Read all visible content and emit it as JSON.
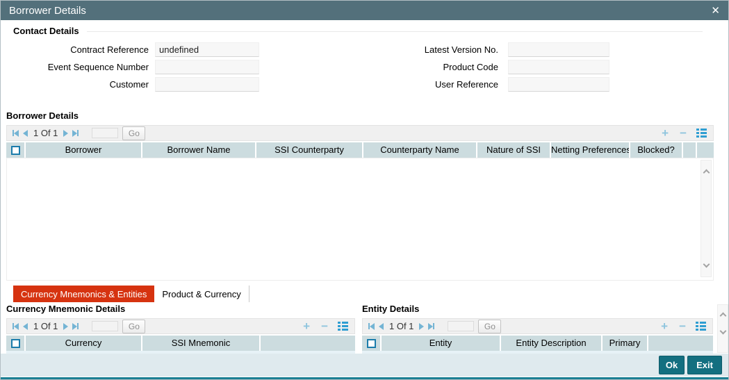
{
  "window": {
    "title": "Borrower Details"
  },
  "icons": {
    "close": "✕",
    "add": "+",
    "remove": "−"
  },
  "colors": {
    "titlebar": "#53707b",
    "button_teal": "#136f80",
    "tab_active_red": "#d63310",
    "grid_header": "#ccdcdf",
    "footer_bg": "#dfeaee",
    "pagination_arrow": "#74b4d4",
    "grid_icon_blue": "#2f9ed2",
    "checkbox_border": "#1b7cab"
  },
  "contact_details": {
    "title": "Contact Details",
    "left_fields": [
      {
        "label": "Contract Reference",
        "value": "undefined"
      },
      {
        "label": "Event Sequence Number",
        "value": ""
      },
      {
        "label": "Customer",
        "value": ""
      }
    ],
    "right_fields": [
      {
        "label": "Latest Version No.",
        "value": ""
      },
      {
        "label": "Product Code",
        "value": ""
      },
      {
        "label": "User Reference",
        "value": ""
      }
    ]
  },
  "borrower_grid": {
    "title": "Borrower Details",
    "pagination": {
      "page": "1 Of 1",
      "go": "Go",
      "goto_value": ""
    },
    "columns": [
      "Borrower",
      "Borrower Name",
      "SSI Counterparty",
      "Counterparty Name",
      "Nature of SSI",
      "Netting Preferences",
      "Blocked?"
    ],
    "rows": []
  },
  "tabs": [
    {
      "label": "Currency Mnemonics & Entities",
      "active": true
    },
    {
      "label": "Product & Currency",
      "active": false
    }
  ],
  "currency_grid": {
    "title": "Currency Mnemonic Details",
    "pagination": {
      "page": "1 Of 1",
      "go": "Go",
      "goto_value": ""
    },
    "columns": [
      "Currency",
      "SSI Mnemonic"
    ],
    "rows": []
  },
  "entity_grid": {
    "title": "Entity Details",
    "pagination": {
      "page": "1 Of 1",
      "go": "Go",
      "goto_value": ""
    },
    "columns": [
      "Entity",
      "Entity Description",
      "Primary"
    ],
    "rows": []
  },
  "footer": {
    "ok": "Ok",
    "exit": "Exit"
  }
}
